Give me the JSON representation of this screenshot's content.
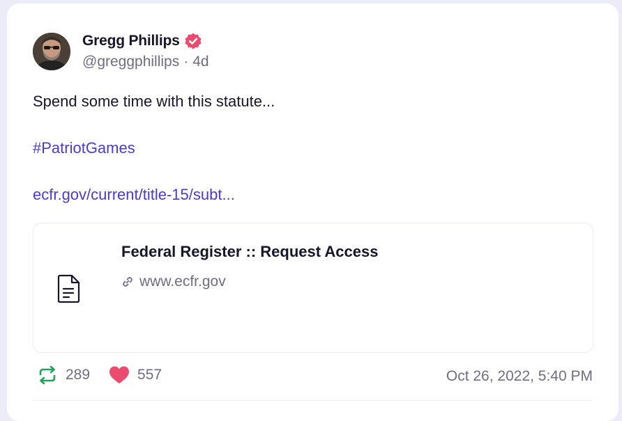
{
  "post": {
    "author": {
      "display_name": "Gregg Phillips",
      "handle": "@greggphillips",
      "verified": true,
      "avatar_icon": "user-avatar"
    },
    "age": "4d",
    "separator": "·",
    "text": "Spend some time with this statute...",
    "hashtag": "#PatriotGames",
    "link_text": "ecfr.gov/current/title-15/subt...",
    "link_card": {
      "title": "Federal Register :: Request Access",
      "domain": "www.ecfr.gov",
      "thumbnail_icon": "document-icon"
    },
    "stats": {
      "reposts": "289",
      "likes": "557"
    },
    "timestamp": "Oct 26, 2022, 5:40 PM"
  },
  "colors": {
    "accent": "#4a3cc6",
    "verified_badge": "#ea4b6f",
    "repost_icon": "#21a35a",
    "like_icon": "#ea4b6f",
    "muted_text": "#6f6d80",
    "primary_text": "#17152a"
  }
}
